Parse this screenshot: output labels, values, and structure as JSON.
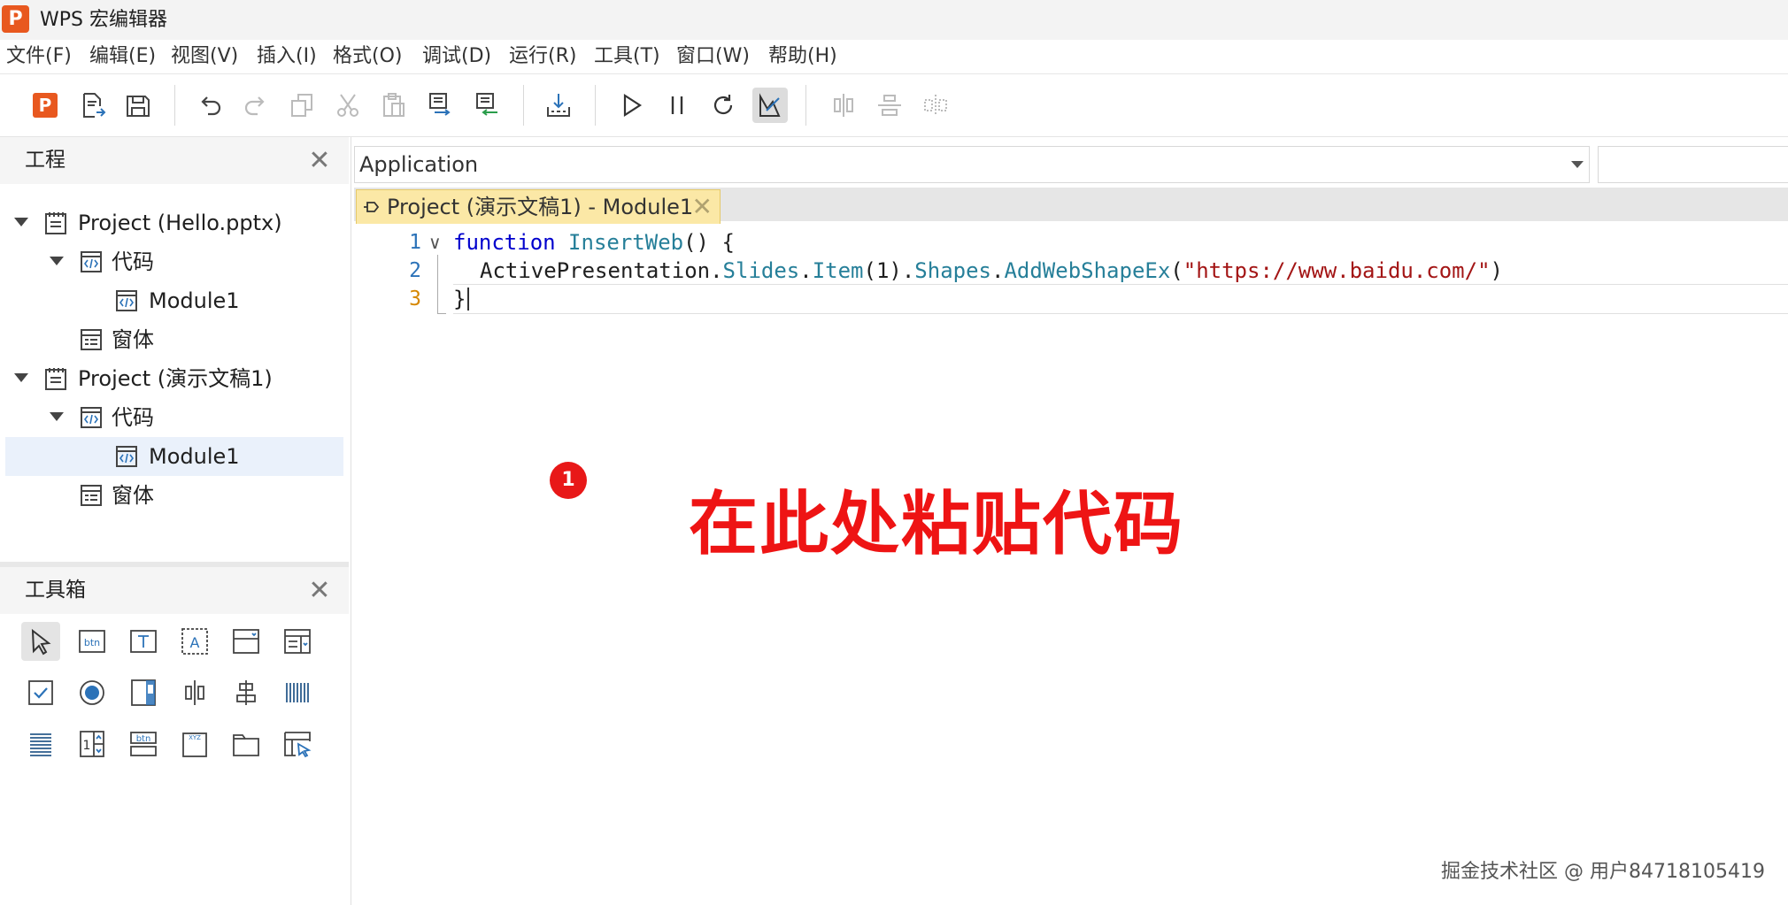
{
  "window": {
    "logo_letter": "P",
    "title": "WPS 宏编辑器"
  },
  "menu": [
    "文件(F)",
    "编辑(E)",
    "视图(V)",
    "插入(I)",
    "格式(O)",
    "调试(D)",
    "运行(R)",
    "工具(T)",
    "窗口(W)",
    "帮助(H)"
  ],
  "toolbar": {
    "icons": [
      "wps-presentation-icon",
      "export-file-icon",
      "save-icon",
      "undo-icon",
      "redo-icon",
      "copy-icon",
      "cut-icon",
      "paste-icon",
      "comment-block-icon",
      "uncomment-block-icon",
      "import-icon",
      "run-icon",
      "pause-icon",
      "reset-icon",
      "design-mode-icon",
      "align-center-icon",
      "align-middle-icon",
      "distribute-icon"
    ],
    "active": "design-mode-icon"
  },
  "project_panel": {
    "title": "工程",
    "close": "✕",
    "tree": [
      {
        "label": "Project (Hello.pptx)",
        "level": 0,
        "expanded": true,
        "icon": "project-icon"
      },
      {
        "label": "代码",
        "level": 1,
        "expanded": true,
        "icon": "code-folder-icon"
      },
      {
        "label": "Module1",
        "level": 2,
        "icon": "module-icon"
      },
      {
        "label": "窗体",
        "level": 1,
        "icon": "form-icon"
      },
      {
        "label": "Project (演示文稿1)",
        "level": 0,
        "expanded": true,
        "icon": "project-icon"
      },
      {
        "label": "代码",
        "level": 1,
        "expanded": true,
        "icon": "code-folder-icon"
      },
      {
        "label": "Module1",
        "level": 2,
        "icon": "module-icon",
        "selected": true
      },
      {
        "label": "窗体",
        "level": 1,
        "icon": "form-icon"
      }
    ]
  },
  "toolbox": {
    "title": "工具箱",
    "close": "✕",
    "tools": [
      "pointer-icon",
      "button-icon",
      "label-icon",
      "text-box-icon",
      "frame-icon",
      "combo-box-icon",
      "checkbox-icon",
      "option-button-icon",
      "scrollbar-icon",
      "spin-horizontal-icon",
      "align-icon",
      "bars-icon",
      "list-icon",
      "spin-button-icon",
      "command-button-icon",
      "image-icon",
      "folder-icon",
      "multi-page-icon"
    ]
  },
  "editor": {
    "object_combo": "Application",
    "tab": {
      "label": "Project (演示文稿1) - Module1",
      "close": "✕"
    },
    "lines": [
      {
        "num": "1",
        "fold": "∨"
      },
      {
        "num": "2"
      },
      {
        "num": "3",
        "current": true
      }
    ],
    "code": {
      "l1_kw": "function",
      "l1_name": "InsertWeb",
      "l1_rest": "() {",
      "l2_obj": "ActivePresentation",
      "l2_p1": "Slides",
      "l2_p2": "Item",
      "l2_arg": "(1).",
      "l2_p3": "Shapes",
      "l2_p4": "AddWebShapeEx",
      "l2_str": "\"https://www.baidu.com/\"",
      "l3": "}"
    }
  },
  "annotation": {
    "badge": "1",
    "text": "在此处粘贴代码"
  },
  "watermark": "掘金技术社区 @ 用户84718105419",
  "colors": {
    "accent": "#e8581f",
    "annotation": "#ee1414",
    "tab_bg": "#fbe8a6",
    "keyword": "#0000cd",
    "string": "#a31515"
  }
}
